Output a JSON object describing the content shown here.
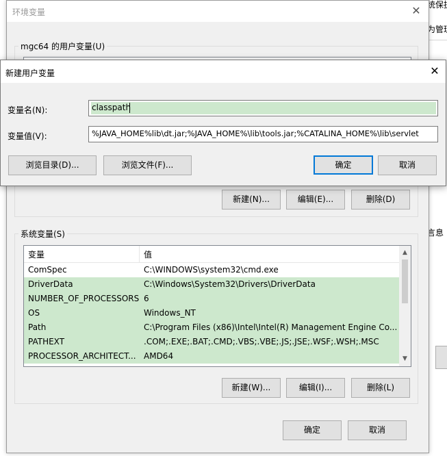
{
  "background": {
    "text1": "统保护",
    "text2": "为管理",
    "text3": "言息"
  },
  "env_dialog": {
    "title": "环境变量",
    "user_vars_group": "mgc64 的用户变量(U)",
    "user_buttons": {
      "new": "新建(N)...",
      "edit": "编辑(E)...",
      "delete": "删除(D)"
    },
    "system_vars_group": "系统变量(S)",
    "columns": {
      "variable": "变量",
      "value": "值"
    },
    "system_rows": [
      {
        "name": "ComSpec",
        "value": "C:\\WINDOWS\\system32\\cmd.exe",
        "selected": false
      },
      {
        "name": "DriverData",
        "value": "C:\\Windows\\System32\\Drivers\\DriverData",
        "selected": true
      },
      {
        "name": "NUMBER_OF_PROCESSORS",
        "value": "6",
        "selected": true
      },
      {
        "name": "OS",
        "value": "Windows_NT",
        "selected": true
      },
      {
        "name": "Path",
        "value": "C:\\Program Files (x86)\\Intel\\Intel(R) Management Engine Co...",
        "selected": true
      },
      {
        "name": "PATHEXT",
        "value": ".COM;.EXE;.BAT;.CMD;.VBS;.VBE;.JS;.JSE;.WSF;.WSH;.MSC",
        "selected": true
      },
      {
        "name": "PROCESSOR_ARCHITECT...",
        "value": "AMD64",
        "selected": true
      }
    ],
    "system_buttons": {
      "new": "新建(W)...",
      "edit": "编辑(I)...",
      "delete": "删除(L)"
    },
    "ok": "确定",
    "cancel": "取消"
  },
  "new_var_dialog": {
    "title": "新建用户变量",
    "name_label": "变量名(N):",
    "name_value": "classpath",
    "value_label": "变量值(V):",
    "value_value": "%JAVA_HOME%lib\\dt.jar;%JAVA_HOME%\\lib\\tools.jar;%CATALINA_HOME%\\lib\\servlet",
    "browse_dir": "浏览目录(D)...",
    "browse_file": "浏览文件(F)...",
    "ok": "确定",
    "cancel": "取消"
  },
  "colors": {
    "selection": "#cde8cd",
    "focus_border": "#0078d7"
  },
  "icons": {
    "close": "close-icon",
    "scroll_up": "chevron-up-icon",
    "scroll_down": "chevron-down-icon"
  }
}
